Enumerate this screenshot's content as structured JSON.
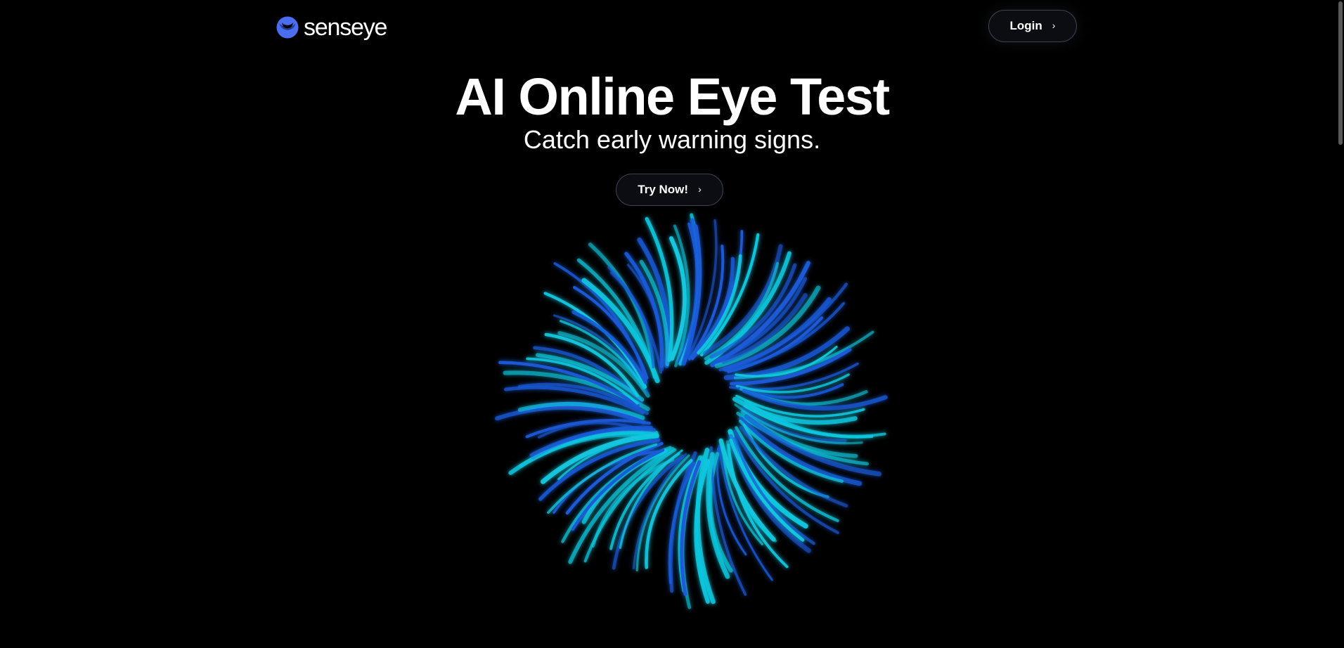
{
  "header": {
    "brand": "senseye",
    "login_label": "Login",
    "chevron": "›"
  },
  "hero": {
    "title": "AI Online Eye Test",
    "subtitle": "Catch early warning signs.",
    "cta_label": "Try Now!"
  },
  "icons": {
    "logo": "senseye-logo-icon",
    "chevron": "chevron-right-icon",
    "illustration": "iris-illustration"
  },
  "colors": {
    "background": "#000000",
    "logo_blue": "#4b6ef0",
    "iris_cyan": "#12c8e0",
    "iris_blue": "#1a5ad8",
    "button_bg": "#0b0d12",
    "button_border": "#3c4250"
  }
}
